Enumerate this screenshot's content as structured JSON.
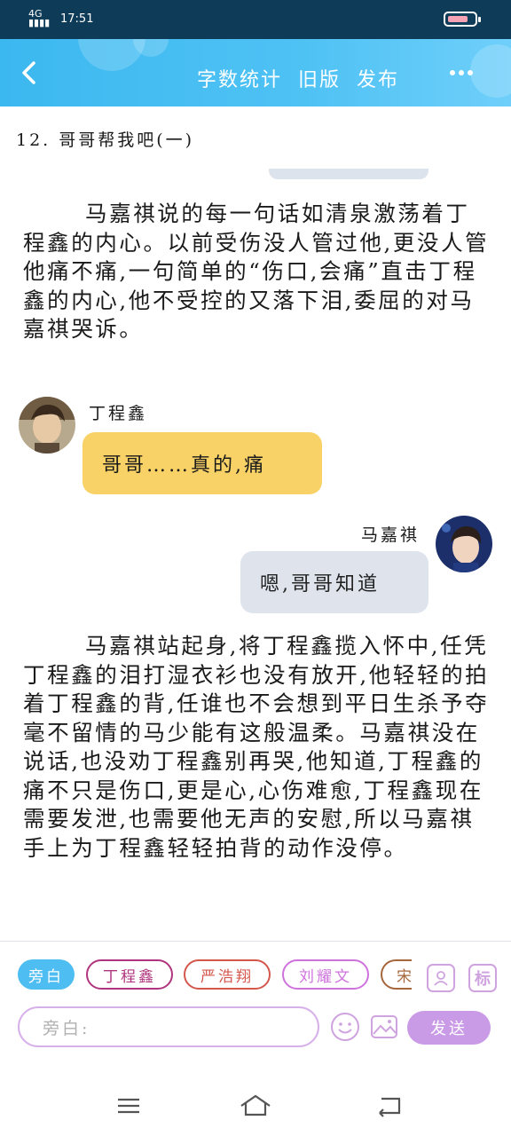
{
  "status_bar": {
    "network": "4G",
    "time": "17:51"
  },
  "header": {
    "back_icon": "chevron-left-icon",
    "word_count_label": "字数统计",
    "old_version_label": "旧版",
    "publish_label": "发布",
    "more_icon": "more-dots-icon"
  },
  "chapter_title": "12. 哥哥帮我吧(一)",
  "messages": [
    {
      "type": "narration",
      "text": "马嘉祺说的每一句话如清泉激荡着丁程鑫的内心。以前受伤没人管过他,更没人管他痛不痛,一句简单的“伤口,会痛”直击丁程鑫的内心,他不受控的又落下泪,委屈的对马嘉祺哭诉。"
    },
    {
      "type": "dialogue",
      "side": "left",
      "speaker": "丁程鑫",
      "text": "哥哥……真的,痛",
      "bubble_color": "#f8d266"
    },
    {
      "type": "dialogue",
      "side": "right",
      "speaker": "马嘉祺",
      "text": "嗯,哥哥知道",
      "bubble_color": "#dfe4ec"
    },
    {
      "type": "narration",
      "text": "马嘉祺站起身,将丁程鑫揽入怀中,任凭丁程鑫的泪打湿衣衫也没有放开,他轻轻的拍着丁程鑫的背,任谁也不会想到平日生杀予夺毫不留情的马少能有这般温柔。马嘉祺没在说话,也没劝丁程鑫别再哭,他知道,丁程鑫的痛不只是伤口,更是心,心伤难愈,丁程鑫现在需要发泄,也需要他无声的安慰,所以马嘉祺手上为丁程鑫轻轻拍背的动作没停。"
    }
  ],
  "role_chips": [
    {
      "label": "旁白",
      "selected": true,
      "color": "#4dbdf2"
    },
    {
      "label": "丁程鑫",
      "selected": false,
      "color": "#b0357e"
    },
    {
      "label": "严浩翔",
      "selected": false,
      "color": "#d4574c"
    },
    {
      "label": "刘耀文",
      "selected": false,
      "color": "#cf72de"
    },
    {
      "label": "宋",
      "selected": false,
      "color": "#a5663b"
    }
  ],
  "composer": {
    "placeholder": "旁白:",
    "send_label": "发送",
    "role_manage_icon": "person-card-icon",
    "tag_icon_label": "标",
    "emoji_icon": "smiley-icon",
    "image_icon": "image-icon"
  },
  "nav_bar": {
    "menu_icon": "menu-icon",
    "home_icon": "home-icon",
    "back_icon": "back-icon"
  },
  "colors": {
    "accent": "#3cb8f0",
    "send": "#c99ae6",
    "chip_border": "#cfa3df"
  }
}
